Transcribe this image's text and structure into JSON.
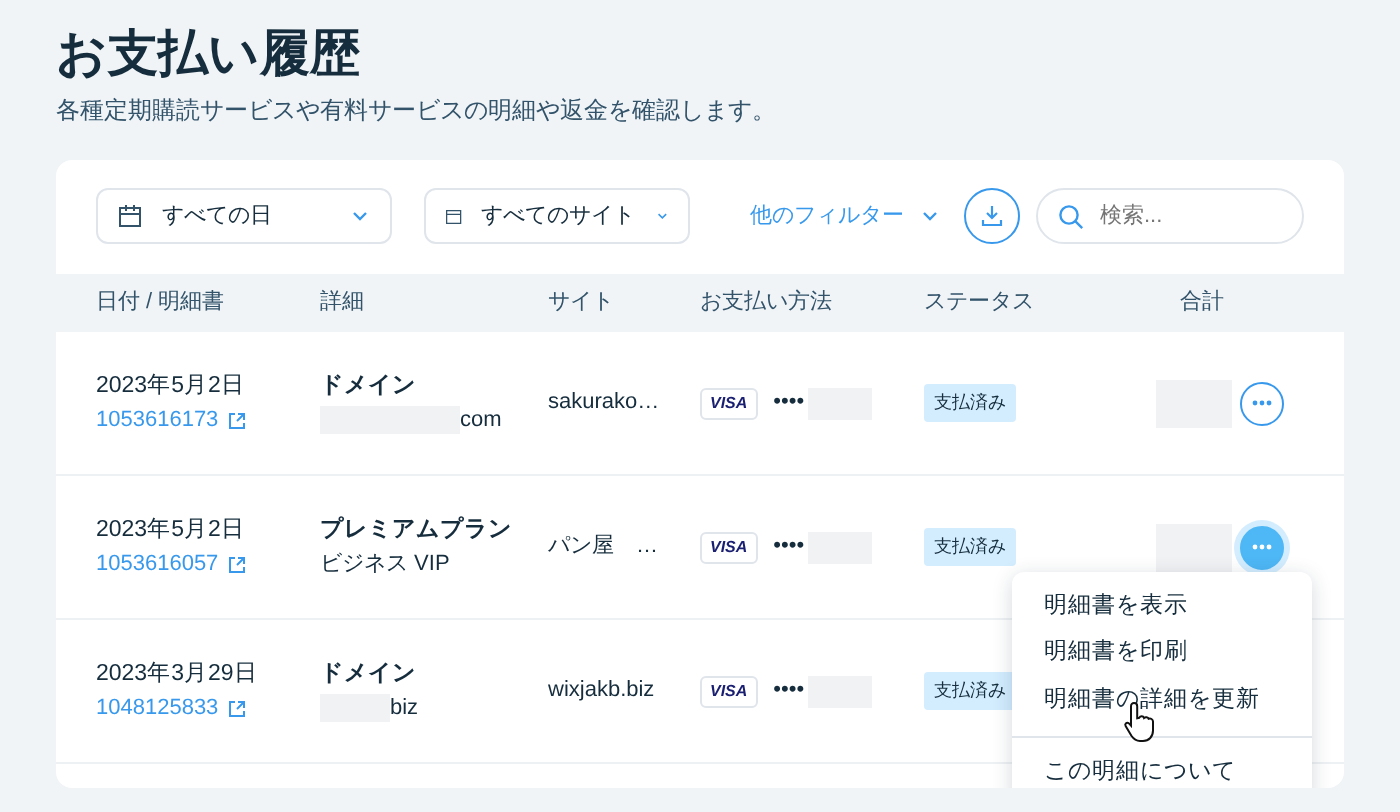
{
  "page": {
    "title": "お支払い履歴",
    "subtitle": "各種定期購読サービスや有料サービスの明細や返金を確認します。"
  },
  "filters": {
    "date": "すべての日",
    "site": "すべてのサイト",
    "more": "他のフィルター",
    "search_placeholder": "検索..."
  },
  "table": {
    "columns": [
      "日付 / 明細書",
      "詳細",
      "サイト",
      "お支払い方法",
      "ステータス",
      "合計"
    ],
    "rows": [
      {
        "date": "2023年5月2日",
        "invoice": "1053616173",
        "product": "ドメイン",
        "detail": "com",
        "site": "sakurako…",
        "card": "VISA",
        "masked": "••••",
        "status": "支払済み",
        "menu_open": false
      },
      {
        "date": "2023年5月2日",
        "invoice": "1053616057",
        "product": "プレミアムプラン",
        "detail": "ビジネス VIP",
        "site": "パン屋　…",
        "card": "VISA",
        "masked": "••••",
        "status": "支払済み",
        "menu_open": true
      },
      {
        "date": "2023年3月29日",
        "invoice": "1048125833",
        "product": "ドメイン",
        "detail": "biz",
        "site": "wixjakb.biz",
        "card": "VISA",
        "masked": "••••",
        "status": "支払済み",
        "menu_open": false
      }
    ]
  },
  "menu": {
    "sections": [
      {
        "items": [
          "明細書を表示",
          "明細書を印刷",
          "明細書の詳細を更新"
        ]
      },
      {
        "items": [
          "この明細について"
        ]
      }
    ]
  }
}
